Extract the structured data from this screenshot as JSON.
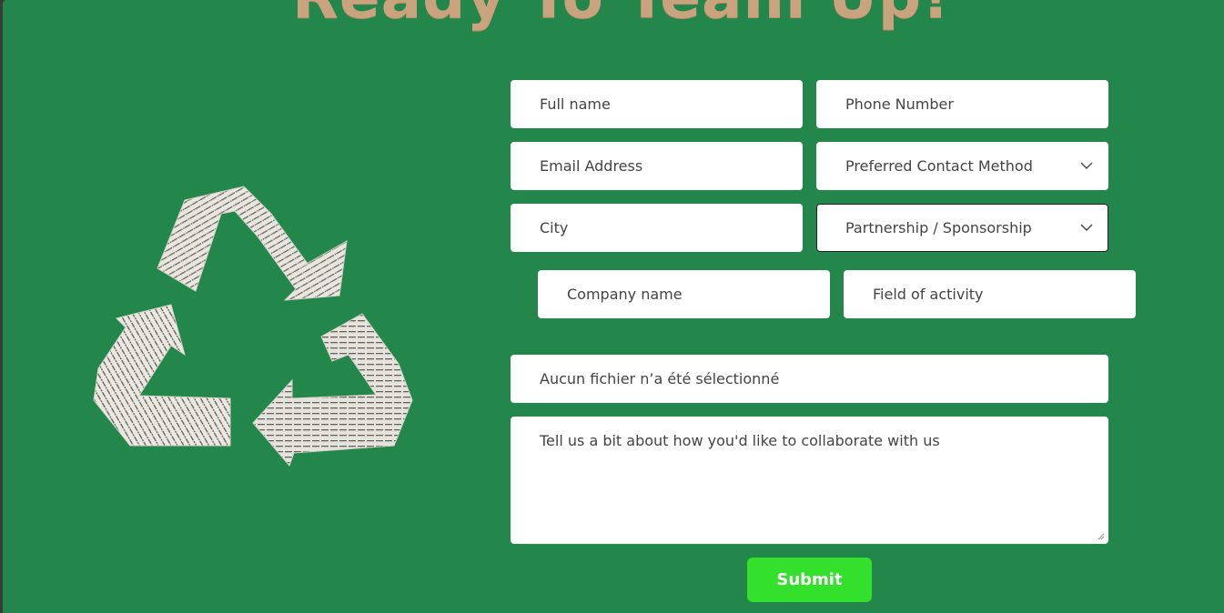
{
  "header": {
    "title": "Ready To Team Up!"
  },
  "form": {
    "full_name_placeholder": "Full name",
    "phone_placeholder": "Phone Number",
    "email_placeholder": "Email Address",
    "contact_method_value": "Preferred Contact Method",
    "city_placeholder": "City",
    "collab_type_value": "Partnership / Sponsorship",
    "company_placeholder": "Company name",
    "field_activity_placeholder": "Field of activity",
    "file_status": "Aucun fichier n’a été sélectionné",
    "message_placeholder": "Tell us a bit about how you'd like to collaborate with us",
    "submit_label": "Submit"
  },
  "icons": {
    "recycle": "recycle-icon",
    "chevron": "chevron-down-icon"
  },
  "colors": {
    "background": "#23864a",
    "headline": "#c9a27e",
    "submit": "#33e02b",
    "field": "#ffffff"
  }
}
